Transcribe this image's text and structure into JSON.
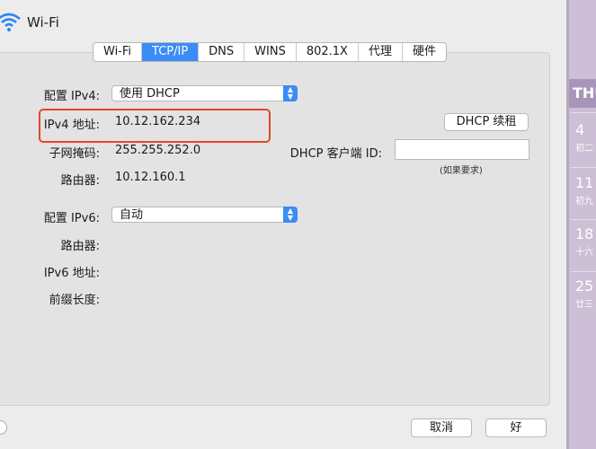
{
  "window": {
    "title": "Wi-Fi"
  },
  "tabs": [
    {
      "label": "Wi-Fi",
      "active": false
    },
    {
      "label": "TCP/IP",
      "active": true
    },
    {
      "label": "DNS",
      "active": false
    },
    {
      "label": "WINS",
      "active": false
    },
    {
      "label": "802.1X",
      "active": false
    },
    {
      "label": "代理",
      "active": false
    },
    {
      "label": "硬件",
      "active": false
    }
  ],
  "ipv4": {
    "config_label": "配置 IPv4:",
    "config_value": "使用 DHCP",
    "address_label": "IPv4 地址:",
    "address_value": "10.12.162.234",
    "subnet_label": "子网掩码:",
    "subnet_value": "255.255.252.0",
    "router_label": "路由器:",
    "router_value": "10.12.160.1"
  },
  "dhcp": {
    "renew_button": "DHCP 续租",
    "client_id_label": "DHCP 客户端 ID:",
    "client_id_value": "",
    "client_id_hint": "(如果要求)"
  },
  "ipv6": {
    "config_label": "配置 IPv6:",
    "config_value": "自动",
    "router_label": "路由器:",
    "address_label": "IPv6 地址:",
    "prefix_label": "前缀长度:"
  },
  "footer": {
    "cancel_label": "取消",
    "ok_label": "好"
  },
  "background_calendar": {
    "header": "THU",
    "days": [
      {
        "num": "4",
        "lunar": "初二"
      },
      {
        "num": "11",
        "lunar": "初九"
      },
      {
        "num": "18",
        "lunar": "十六"
      },
      {
        "num": "25",
        "lunar": "廿三"
      }
    ]
  },
  "colors": {
    "accent": "#3b8cf6",
    "highlight": "#e5452c"
  }
}
